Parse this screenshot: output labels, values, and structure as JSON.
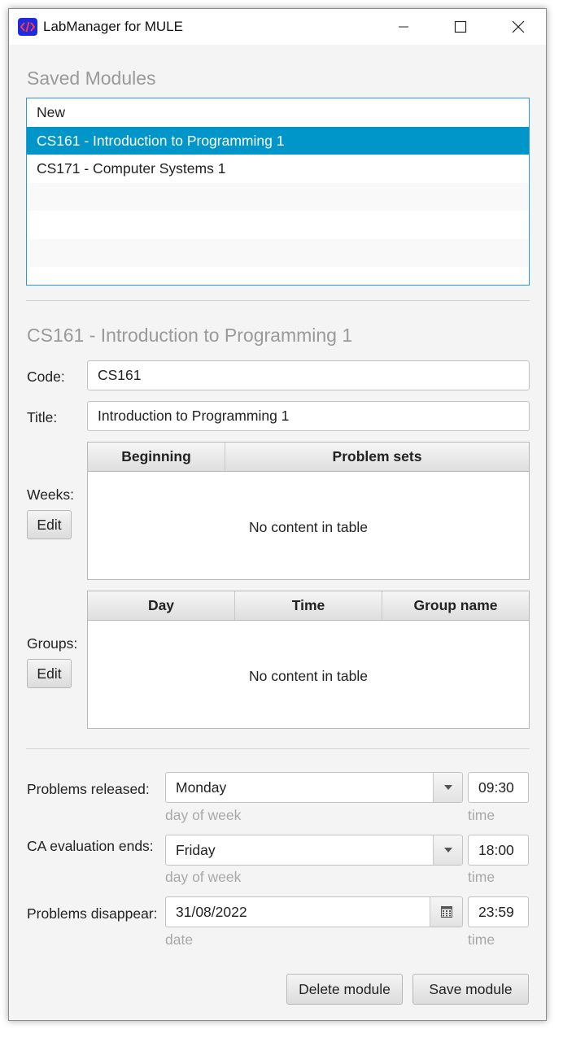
{
  "window": {
    "title": "LabManager for MULE",
    "icon": "code-brackets-icon",
    "controls": [
      "minimize-icon",
      "maximize-icon",
      "close-icon"
    ]
  },
  "saved_modules": {
    "heading": "Saved Modules",
    "items": [
      {
        "label": "New",
        "selected": false
      },
      {
        "label": "CS161 - Introduction to Programming 1",
        "selected": true
      },
      {
        "label": "CS171 - Computer Systems 1",
        "selected": false
      }
    ]
  },
  "module": {
    "heading": "CS161 - Introduction to Programming 1",
    "code_label": "Code:",
    "code_value": "CS161",
    "title_label": "Title:",
    "title_value": "Introduction to Programming 1",
    "weeks": {
      "label": "Weeks:",
      "edit_label": "Edit",
      "columns": [
        "Beginning",
        "Problem sets"
      ],
      "empty_text": "No content in table"
    },
    "groups": {
      "label": "Groups:",
      "edit_label": "Edit",
      "columns": [
        "Day",
        "Time",
        "Group name"
      ],
      "empty_text": "No content in table"
    }
  },
  "schedule": {
    "problems_released": {
      "label": "Problems released:",
      "day": "Monday",
      "day_hint": "day of week",
      "time": "09:30",
      "time_hint": "time"
    },
    "ca_evaluation_ends": {
      "label": "CA evaluation ends:",
      "day": "Friday",
      "day_hint": "day of week",
      "time": "18:00",
      "time_hint": "time"
    },
    "problems_disappear": {
      "label": "Problems disappear:",
      "date": "31/08/2022",
      "date_hint": "date",
      "time": "23:59",
      "time_hint": "time"
    }
  },
  "actions": {
    "delete_label": "Delete module",
    "save_label": "Save module"
  },
  "colors": {
    "selection": "#0096c9",
    "list_border": "#2a9bd6",
    "heading_gray": "#9a9a9a",
    "hint_gray": "#a8a8a8",
    "app_icon": "#1e2be0"
  }
}
